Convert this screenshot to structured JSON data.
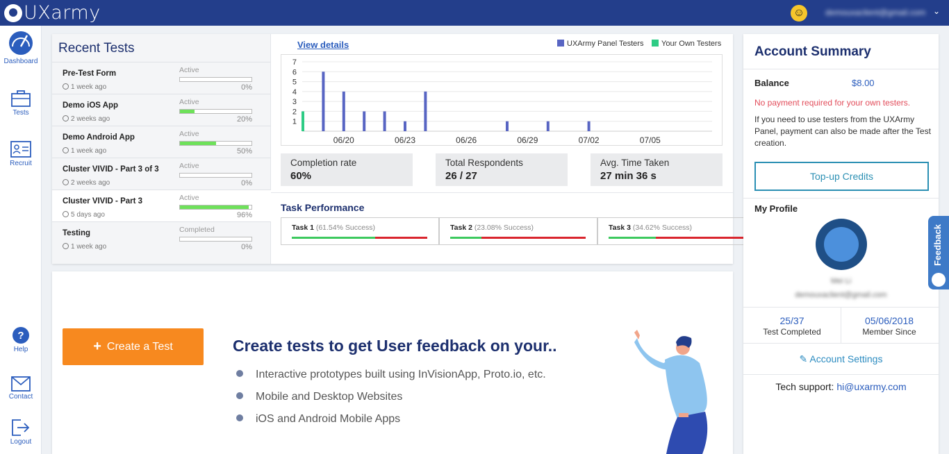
{
  "header": {
    "brand": "UXarmy",
    "user_email": "demouxaclient@gmail.com"
  },
  "sidebar": {
    "items": [
      {
        "label": "Dashboard",
        "icon": "dashboard-icon"
      },
      {
        "label": "Tests",
        "icon": "briefcase-icon"
      },
      {
        "label": "Recruit",
        "icon": "id-card-icon"
      },
      {
        "label": "Help",
        "icon": "help-icon"
      },
      {
        "label": "Contact",
        "icon": "mail-icon"
      },
      {
        "label": "Logout",
        "icon": "logout-icon"
      }
    ]
  },
  "recent_tests": {
    "title": "Recent Tests",
    "items": [
      {
        "name": "Pre-Test Form",
        "time": "1 week ago",
        "status": "Active",
        "progress": 0,
        "pct": "0%"
      },
      {
        "name": "Demo iOS App",
        "time": "2 weeks ago",
        "status": "Active",
        "progress": 20,
        "pct": "20%"
      },
      {
        "name": "Demo Android App",
        "time": "1 week ago",
        "status": "Active",
        "progress": 50,
        "pct": "50%"
      },
      {
        "name": "Cluster VIVID - Part 3 of 3",
        "time": "2 weeks ago",
        "status": "Active",
        "progress": 0,
        "pct": "0%"
      },
      {
        "name": "Cluster VIVID - Part 3",
        "time": "5 days ago",
        "status": "Active",
        "progress": 96,
        "pct": "96%"
      },
      {
        "name": "Testing",
        "time": "1 week ago",
        "status": "Completed",
        "progress": 0,
        "pct": "0%"
      }
    ]
  },
  "chart_panel": {
    "view_details": "View details",
    "legend": {
      "panel": "UXArmy Panel Testers",
      "own": "Your Own Testers"
    },
    "colors": {
      "panel": "#5865c3",
      "own": "#2ecc85"
    }
  },
  "chart_data": {
    "type": "bar",
    "x": [
      "06/18",
      "06/19",
      "06/20",
      "06/21",
      "06/22",
      "06/23",
      "06/24",
      "06/25",
      "06/26",
      "06/27",
      "06/28",
      "06/29",
      "06/30",
      "07/01",
      "07/02",
      "07/03",
      "07/04",
      "07/05",
      "07/06",
      "07/07"
    ],
    "tick_labels": [
      "06/20",
      "06/23",
      "06/26",
      "06/29",
      "07/02",
      "07/05"
    ],
    "series": [
      {
        "name": "UXArmy Panel Testers",
        "values": [
          2,
          6,
          4,
          2,
          2,
          1,
          4,
          0,
          0,
          0,
          1,
          0,
          1,
          0,
          1,
          0,
          0,
          0,
          0,
          0
        ]
      },
      {
        "name": "Your Own Testers",
        "values": [
          2,
          0,
          0,
          0,
          0,
          0,
          0,
          0,
          0,
          0,
          0,
          0,
          0,
          0,
          0,
          0,
          0,
          0,
          0,
          0
        ]
      }
    ],
    "yticks": [
      1,
      2,
      3,
      4,
      5,
      6,
      7
    ],
    "ylim": [
      0,
      7
    ],
    "grid": true,
    "legend_position": "top-right",
    "stacked": true
  },
  "stats": [
    {
      "label": "Completion rate",
      "value": "60%"
    },
    {
      "label": "Total Respondents",
      "value": "26 / 27"
    },
    {
      "label": "Avg. Time Taken",
      "value": "27 min 36 s"
    }
  ],
  "task_performance": {
    "title": "Task Performance",
    "tasks": [
      {
        "name": "Task 1",
        "success": "(61.54% Success)",
        "rate": 61.54
      },
      {
        "name": "Task 2",
        "success": "(23.08% Success)",
        "rate": 23.08
      },
      {
        "name": "Task 3",
        "success": "(34.62% Success)",
        "rate": 34.62
      }
    ]
  },
  "create": {
    "button": "Create a Test",
    "heading": "Create tests to get User feedback on your..",
    "bullets": [
      "Interactive prototypes built using InVisionApp, Proto.io, etc.",
      "Mobile and Desktop Websites",
      "iOS and Android Mobile Apps"
    ]
  },
  "account": {
    "title": "Account Summary",
    "balance_label": "Balance",
    "balance_value": "$8.00",
    "no_payment": "No payment required for your own testers.",
    "info": "If you need to use testers from the UXArmy Panel, payment can also be made after the Test creation.",
    "topup": "Top-up Credits",
    "profile_label": "My Profile",
    "profile_name": "Mei Li",
    "profile_email": "demouxaclient@gmail.com",
    "tests_completed_value": "25/37",
    "tests_completed_label": "Test Completed",
    "member_since_value": "05/06/2018",
    "member_since_label": "Member Since",
    "settings": "Account Settings",
    "tech_prefix": "Tech support: ",
    "tech_email": "hi@uxarmy.com"
  },
  "feedback_tab": "Feedback"
}
